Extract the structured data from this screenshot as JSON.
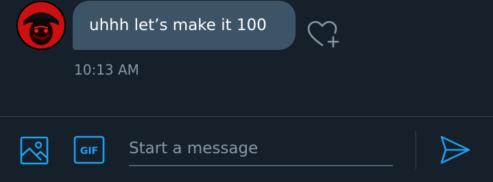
{
  "message": {
    "text": "uhhh let’s make it 100",
    "timestamp": "10:13 AM"
  },
  "composer": {
    "placeholder": "Start a message",
    "gif_label": "GIF"
  },
  "icons": {
    "avatar": "avatar",
    "react": "heart-plus-icon",
    "media": "image-icon",
    "gif": "gif-icon",
    "send": "send-icon"
  },
  "colors": {
    "background": "#15202b",
    "bubble": "#3d5466",
    "accent": "#1da1f2",
    "muted": "#8899a6",
    "divider": "#38444d"
  }
}
